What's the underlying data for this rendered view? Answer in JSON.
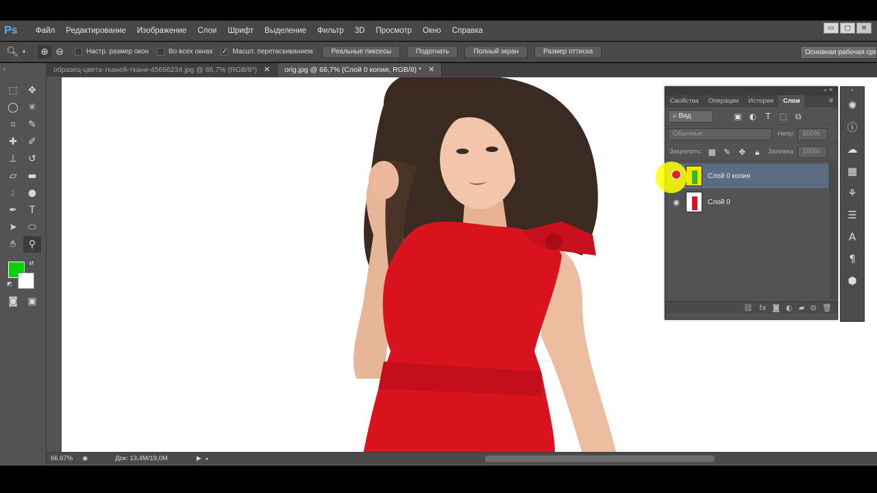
{
  "app": {
    "logo": "Ps"
  },
  "menu": [
    "Файл",
    "Редактирование",
    "Изображение",
    "Слои",
    "Шрифт",
    "Выделение",
    "Фильтр",
    "3D",
    "Просмотр",
    "Окно",
    "Справка"
  ],
  "window_controls": {
    "minimize": "▭",
    "restore": "▢",
    "close": "✕"
  },
  "options": {
    "zoom_tool_icon": "zoom-icon",
    "checkboxes": [
      {
        "label": "Настр. размер окон",
        "checked": false
      },
      {
        "label": "Во всех окнах",
        "checked": false
      },
      {
        "label": "Масшт. перетаскиванием",
        "checked": true
      }
    ],
    "buttons": [
      "Реальные пиксесы",
      "Подогнать",
      "Полный экран",
      "Размер оттиска"
    ],
    "workspace": "Основная рабочая среда"
  },
  "tabs": [
    {
      "label": "образец-цвета-тканей-ткани-45666234.jpg @ 66,7% (RGB/8*)",
      "active": false
    },
    {
      "label": "orig.jpg @ 66,7% (Слой 0 копия, RGB/8) *",
      "active": true
    }
  ],
  "colors": {
    "foreground": "#00d400",
    "background": "#ffffff",
    "accent": "#5c6c82"
  },
  "status": {
    "zoom": "66,67%",
    "doc": "Док: 13,4M/19,0M"
  },
  "layers_panel": {
    "tabs": [
      "Свойства",
      "Операции",
      "История",
      "Слои"
    ],
    "active_tab": "Слои",
    "filter": "Вид",
    "blend_mode": "Обычные",
    "opacity_label": "Непр:",
    "opacity_value": "100%",
    "lock_label": "Закрепить:",
    "fill_label": "Заливка:",
    "fill_value": "100%",
    "layers": [
      {
        "name": "Слой 0 копия",
        "selected": true,
        "visible": true
      },
      {
        "name": "Слой 0",
        "selected": false,
        "visible": true
      }
    ]
  }
}
